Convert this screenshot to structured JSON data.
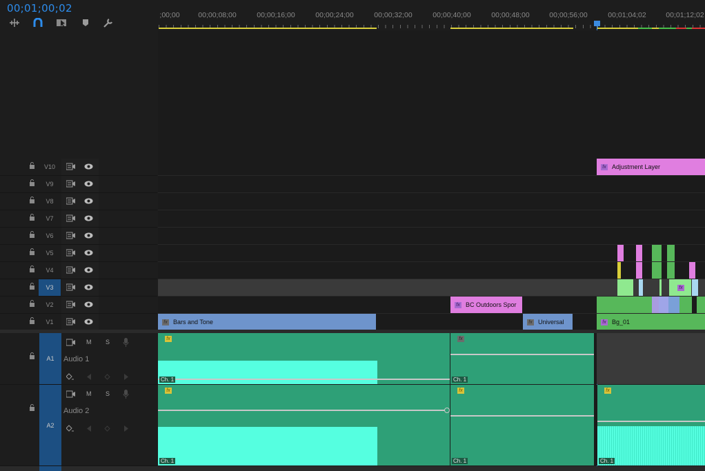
{
  "timecode": "00;01;00;02",
  "ruler": {
    "labels": [
      ";00;00",
      "00;00;08;00",
      "00;00;16;00",
      "00;00;24;00",
      "00;00;32;00",
      "00;00;40;00",
      "00;00;48;00",
      "00;00;56;00",
      "00;01;04;02",
      "00;01;12;02"
    ]
  },
  "tools": [
    "snap-in-icon",
    "magnet-icon",
    "linked-selection-icon",
    "marker-icon",
    "wrench-icon"
  ],
  "video_tracks": [
    {
      "label": "V10"
    },
    {
      "label": "V9"
    },
    {
      "label": "V8"
    },
    {
      "label": "V7"
    },
    {
      "label": "V6"
    },
    {
      "label": "V5"
    },
    {
      "label": "V4"
    },
    {
      "label": "V3",
      "active": true
    },
    {
      "label": "V2"
    },
    {
      "label": "V1"
    }
  ],
  "clips": {
    "adjustment_layer": "Adjustment Layer",
    "bc_outdoors": "BC Outdoors Spor",
    "bars_and_tone": "Bars and Tone",
    "universal": "Universal",
    "bg01": "Bg_01"
  },
  "audio_tracks": [
    {
      "label": "A1",
      "name": "Audio 1"
    },
    {
      "label": "A2",
      "name": "Audio 2"
    }
  ],
  "audio_buttons": {
    "mute": "M",
    "solo": "S"
  },
  "channel_label": "Ch. 1",
  "fx_label": "fx",
  "colors": {
    "accent": "#2d8ceb",
    "audio_clip": "#2ea077",
    "waveform": "#55ffe0",
    "video_clip_blue": "#6e94cc",
    "video_clip_pink": "#e07ee0",
    "video_clip_green": "#57b85a"
  }
}
